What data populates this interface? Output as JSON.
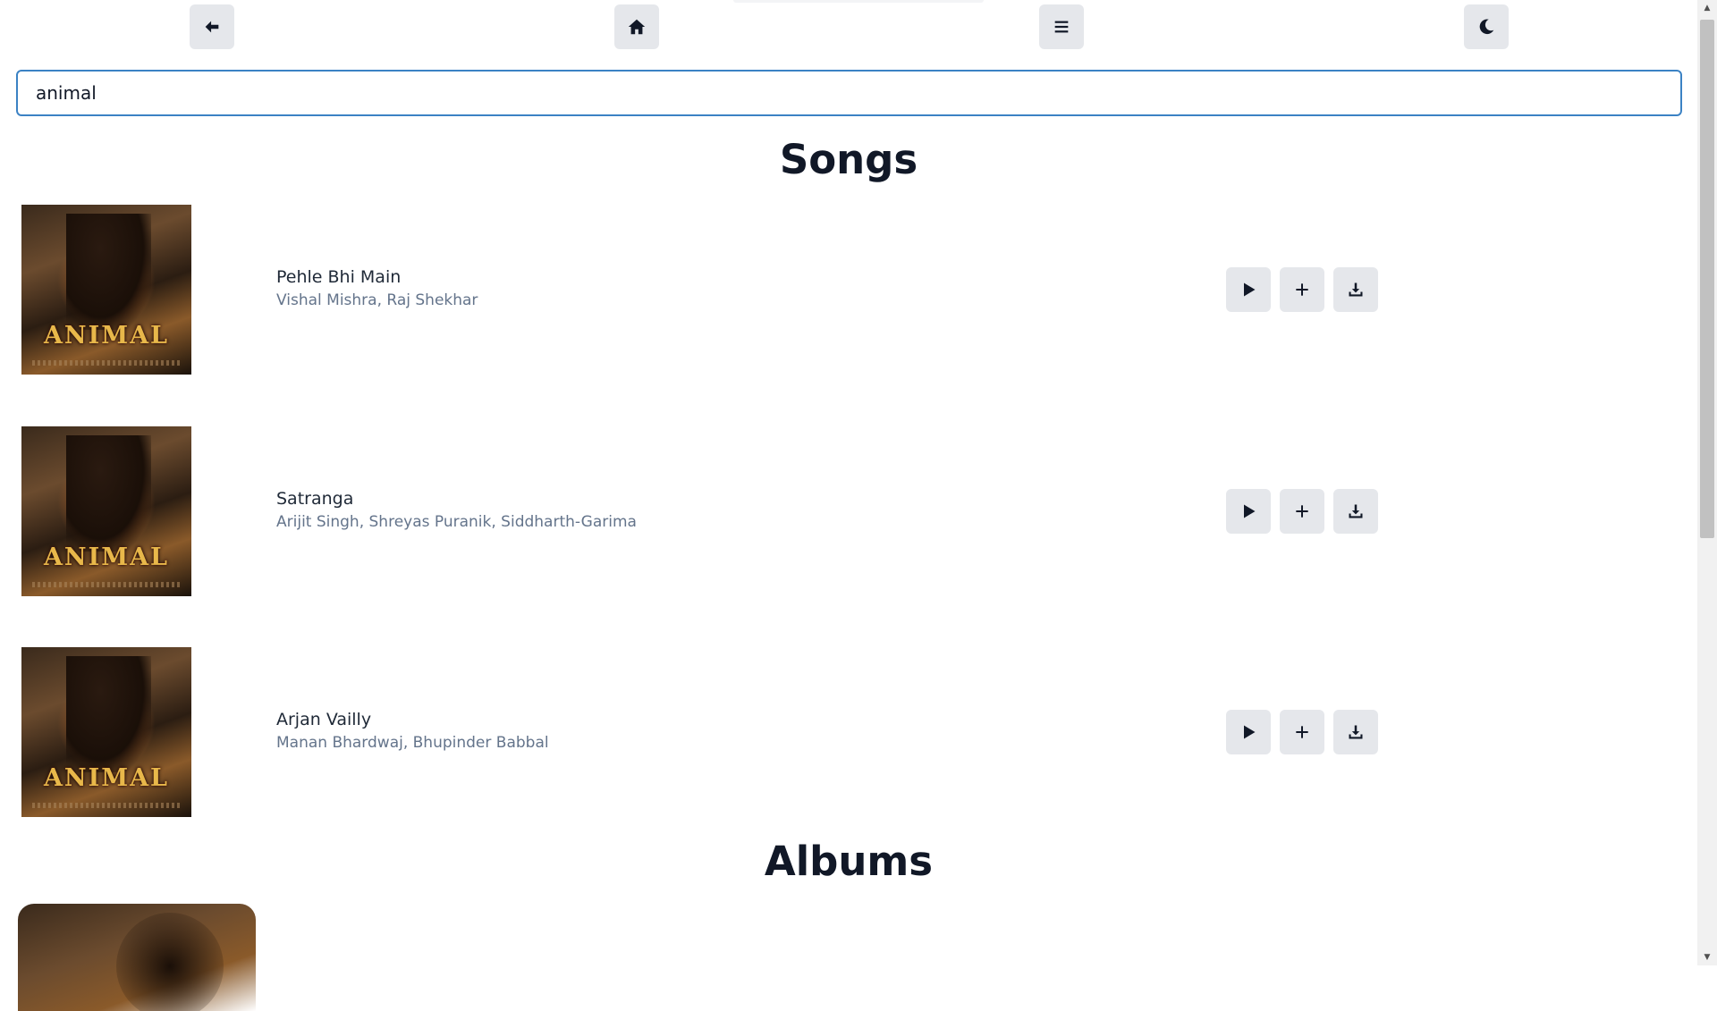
{
  "header": {
    "back_icon": "arrow-left-icon",
    "home_icon": "home-icon",
    "menu_icon": "menu-icon",
    "theme_icon": "moon-icon"
  },
  "search": {
    "value": "animal"
  },
  "sections": {
    "songs_title": "Songs",
    "albums_title": "Albums"
  },
  "songs": [
    {
      "title": "Pehle Bhi Main",
      "artists": "Vishal Mishra, Raj Shekhar",
      "cover_text": "ANIMAL"
    },
    {
      "title": "Satranga",
      "artists": "Arijit Singh, Shreyas Puranik, Siddharth-Garima",
      "cover_text": "ANIMAL"
    },
    {
      "title": "Arjan Vailly",
      "artists": "Manan Bhardwaj, Bhupinder Babbal",
      "cover_text": "ANIMAL"
    }
  ],
  "colors": {
    "button_bg": "#e5e7eb",
    "search_border": "#3b82c4",
    "artist_text": "#64748b"
  }
}
